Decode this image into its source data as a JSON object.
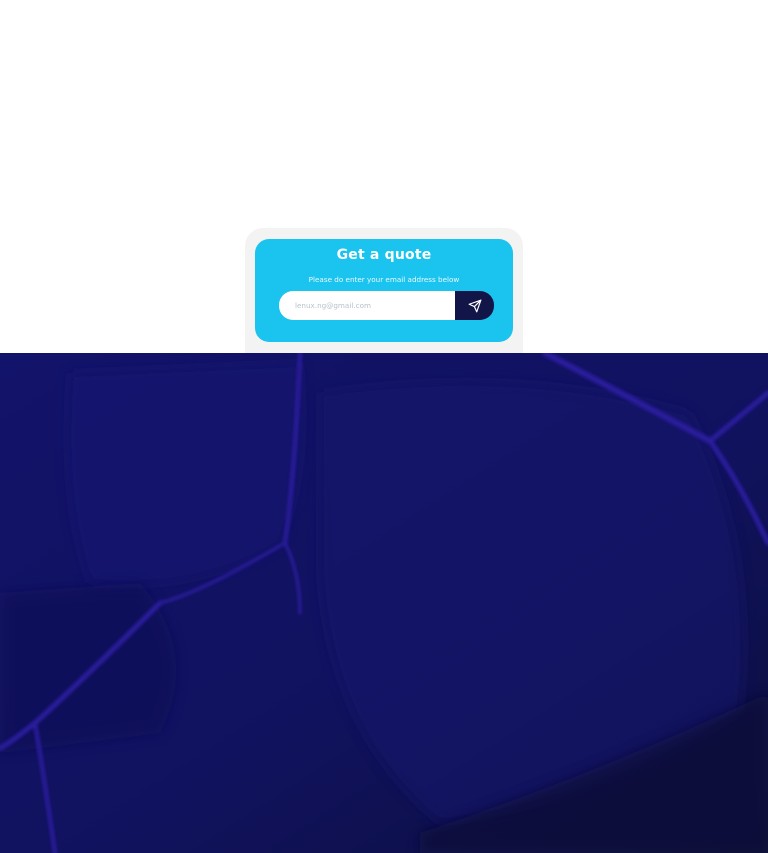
{
  "quote": {
    "title": "Get a quote",
    "subtitle": "Please do enter your email address below",
    "email_placeholder": "lenux.ng@gmail.com",
    "send_icon": "send-icon"
  },
  "colors": {
    "card": "#1ac4ee",
    "card_outer": "#f3f3f4",
    "send_button": "#121548",
    "dark_section": "#0f1159",
    "dark_section_lines": "#2a1c9e"
  }
}
